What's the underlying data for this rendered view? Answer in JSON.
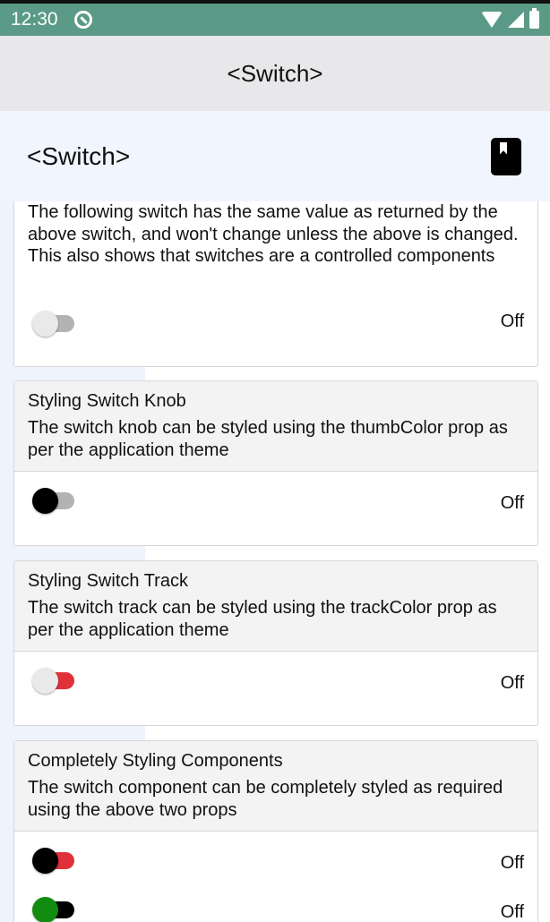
{
  "status_bar": {
    "time": "12:30"
  },
  "app_header": {
    "title": "<Switch>"
  },
  "page_header": {
    "title": "<Switch>"
  },
  "intro_section": {
    "description": "The following switch has the same value as returned by the above switch, and won't change unless the above is changed. This also shows that switches are a controlled components",
    "switch": {
      "state": "Off",
      "thumb_color": "#e9e9e9",
      "track_color": "#b3b3b3"
    }
  },
  "sections": [
    {
      "title": "Styling Switch Knob",
      "description": "The switch knob can be styled using the thumbColor prop as per the application theme",
      "switches": [
        {
          "state": "Off",
          "thumb_color": "#000000",
          "track_color": "#b3b3b3"
        }
      ]
    },
    {
      "title": "Styling Switch Track",
      "description": "The switch track can be styled using the trackColor prop as per the application theme",
      "switches": [
        {
          "state": "Off",
          "thumb_color": "#e9e9e9",
          "track_color": "#e0313a"
        }
      ]
    },
    {
      "title": "Completely Styling Components",
      "description": "The switch component can be completely styled as required using the above two props",
      "switches": [
        {
          "state": "Off",
          "thumb_color": "#000000",
          "track_color": "#e0313a"
        },
        {
          "state": "Off",
          "thumb_color": "#118c11",
          "track_color": "#000000"
        }
      ]
    }
  ],
  "colors": {
    "status_bar": "#5a9a87",
    "header_bg": "#e8e8ea",
    "page_header_bg": "#f1f5fd"
  }
}
